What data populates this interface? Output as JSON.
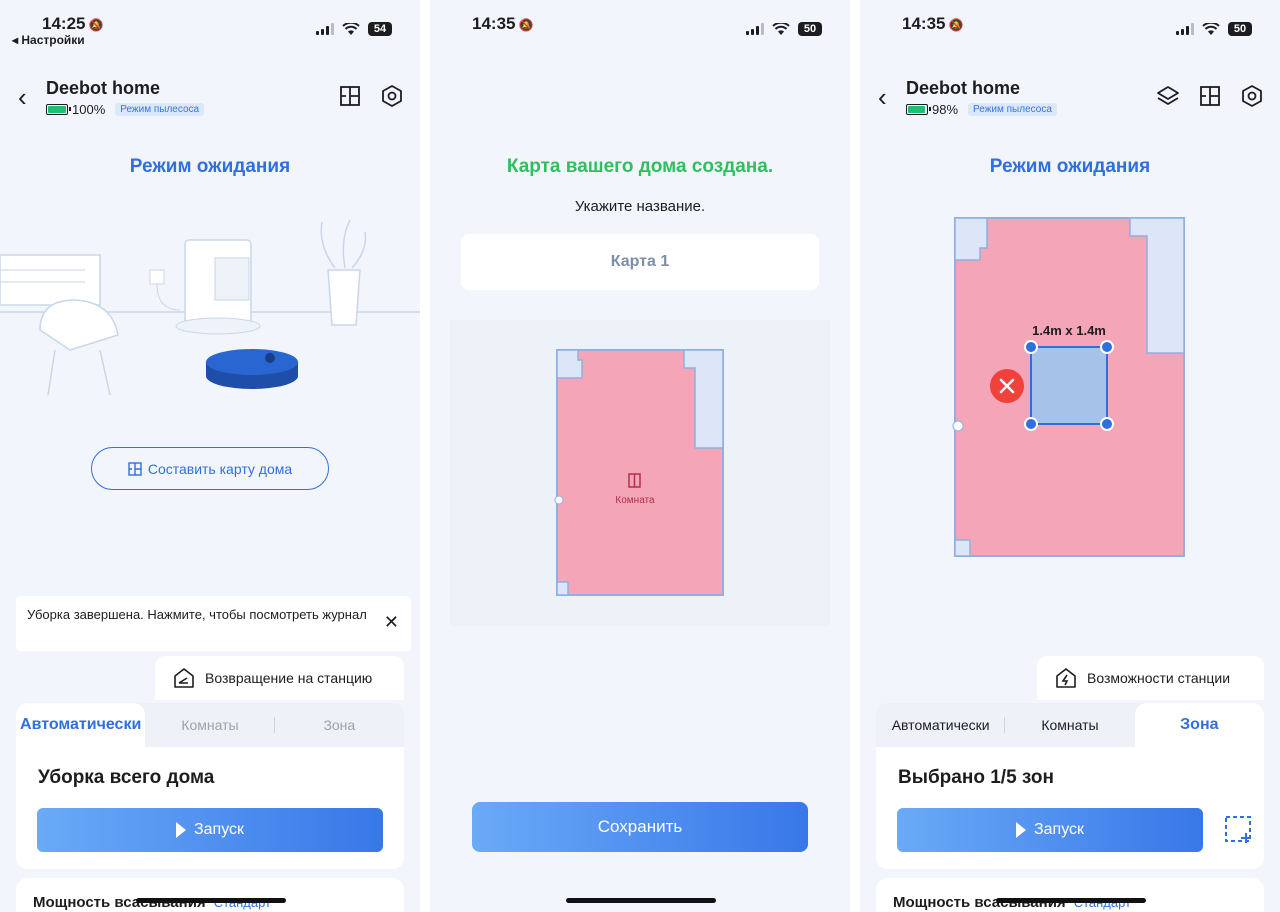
{
  "screen1": {
    "status": {
      "time": "14:25",
      "back_app": "◂ Настройки",
      "battery": "54"
    },
    "device": {
      "name": "Deebot home",
      "battery": "100%",
      "mode_tag": "Режим пылесоса"
    },
    "state": "Режим ожидания",
    "make_map_button": "Составить карту дома",
    "toast": "Уборка завершена. Нажмите, чтобы посмотреть журнал",
    "station_button": "Возвращение на станцию",
    "tabs": [
      "Автоматически",
      "Комнаты",
      "Зона"
    ],
    "main_title": "Уборка всего дома",
    "start_button": "Запуск",
    "suction": {
      "label": "Мощность всасывания",
      "value": "Стандарт"
    }
  },
  "screen2": {
    "status": {
      "time": "14:35",
      "battery": "50"
    },
    "title": "Карта вашего дома создана.",
    "subtitle": "Укажите название.",
    "map_name": "Карта 1",
    "room_label": "Комната",
    "save_button": "Сохранить"
  },
  "screen3": {
    "status": {
      "time": "14:35",
      "battery": "50"
    },
    "device": {
      "name": "Deebot home",
      "battery": "98%",
      "mode_tag": "Режим пылесоса"
    },
    "state": "Режим ожидания",
    "zone_size": "1.4m x 1.4m",
    "station_button": "Возможности станции",
    "tabs": [
      "Автоматически",
      "Комнаты",
      "Зона"
    ],
    "main_title": "Выбрано 1/5 зон",
    "start_button": "Запуск",
    "suction": {
      "label": "Мощность всасывания",
      "value": "Стандарт"
    }
  },
  "colors": {
    "accent": "#2f6fdf",
    "success": "#2fbf5d",
    "room_fill": "#f4a5b8",
    "zone_fill": "#a5c3e8",
    "delete": "#f0413a"
  },
  "icons": [
    "back-chevron-icon",
    "map-icon",
    "settings-hex-icon",
    "layers-icon",
    "station-icon",
    "play-icon",
    "add-zone-icon",
    "close-icon",
    "bell-off-icon",
    "wifi-icon"
  ]
}
